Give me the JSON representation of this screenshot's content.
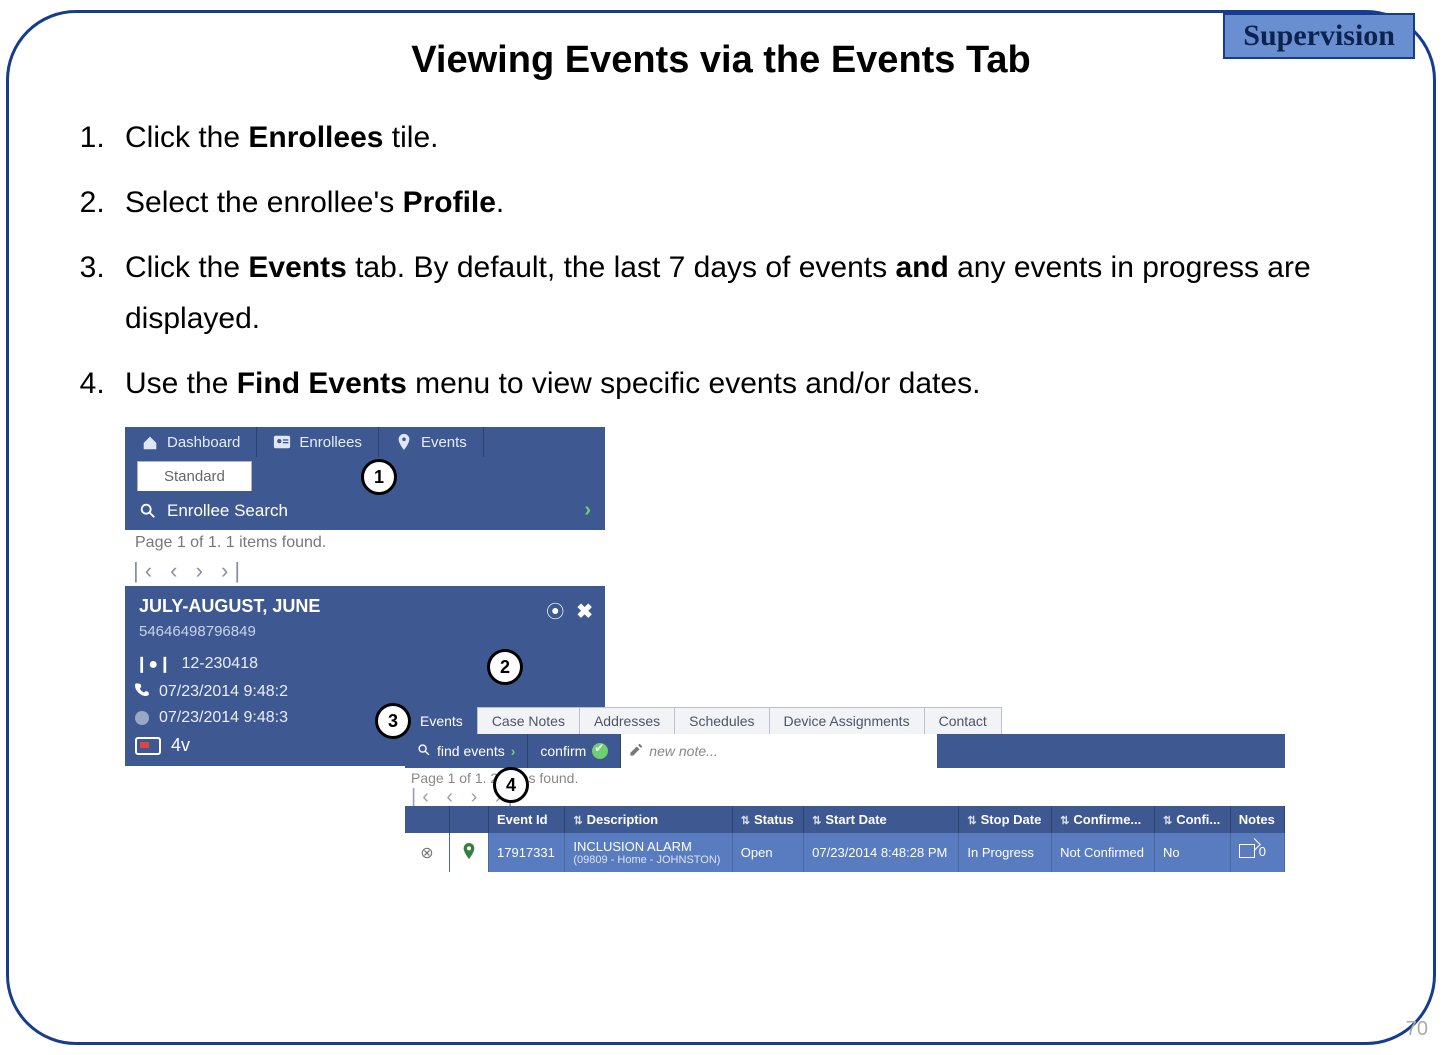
{
  "badge": "Supervision",
  "title": "Viewing Events via the Events Tab",
  "steps": [
    {
      "pre": "Click the ",
      "bold": "Enrollees",
      "post": " tile."
    },
    {
      "pre": "Select the enrollee's ",
      "bold": "Profile",
      "post": "."
    },
    {
      "pre": "Click the ",
      "bold": "Events",
      "post": " tab. By default, the last 7 days of events ",
      "bold2": "and",
      "post2": " any events in progress are displayed."
    },
    {
      "pre": "Use the ",
      "bold": "Find Events",
      "post": " menu to view specific events and/or dates."
    }
  ],
  "page_number": "70",
  "nav": {
    "dashboard": "Dashboard",
    "enrollees": "Enrollees",
    "events": "Events",
    "standard_tab": "Standard"
  },
  "search": {
    "label": "Enrollee Search",
    "page_info": "Page 1 of 1. 1 items found."
  },
  "profile": {
    "name": "JULY-AUGUST, JUNE",
    "id": "54646498796849",
    "device_entries": [
      {
        "icon": "marker",
        "label": "12-230418"
      },
      {
        "icon": "phone",
        "label": "07/23/2014 9:48:2"
      },
      {
        "icon": "dot",
        "label": "07/23/2014 9:48:3"
      }
    ],
    "battery_count": "4v"
  },
  "detail_tabs": [
    "Events",
    "Case Notes",
    "Addresses",
    "Schedules",
    "Device Assignments",
    "Contact"
  ],
  "toolbar": {
    "find": "find events",
    "confirm": "confirm",
    "new_note_placeholder": "new note..."
  },
  "pager2": "Page 1 of 1. 2 items found.",
  "events_table": {
    "headers": [
      "",
      "",
      "Event Id",
      "Description",
      "Status",
      "Start Date",
      "Stop Date",
      "Confirme...",
      "Confi...",
      "Notes"
    ],
    "row": {
      "event_id": "17917331",
      "description_main": "INCLUSION ALARM",
      "description_sub": "(09809 - Home - JOHNSTON)",
      "status": "Open",
      "start": "07/23/2014 8:48:28 PM",
      "stop": "In Progress",
      "confirmed": "Not Confirmed",
      "confi": "No",
      "notes": "0"
    }
  },
  "callouts": [
    "1",
    "2",
    "3",
    "4"
  ]
}
